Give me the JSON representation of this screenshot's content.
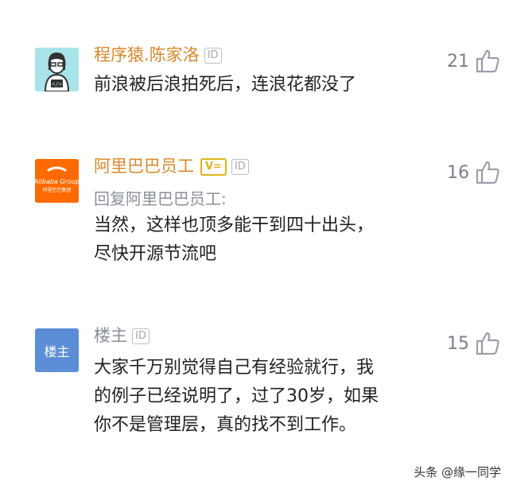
{
  "comments": [
    {
      "username": "程序猿.陈家洛",
      "id_tag": "ID",
      "text": "前浪被后浪拍死后，连浪花都没了",
      "likes": "21",
      "avatar": "programmer-avatar-icon"
    },
    {
      "username": "阿里巴巴员工",
      "v_tag": "V=",
      "id_tag": "ID",
      "reply_to": "回复阿里巴巴员工:",
      "text": "当然，这样也顶多能干到四十出头，\n尽快开源节流吧",
      "likes": "16",
      "avatar_text": "Alibaba Group",
      "avatar_sub": "阿里巴巴集团"
    },
    {
      "username": "楼主",
      "id_tag": "ID",
      "text": "大家千万别觉得自己有经验就行，我\n的例子已经说明了，过了30岁，如果\n你不是管理层，真的找不到工作。",
      "likes": "15",
      "avatar_text": "楼主"
    }
  ],
  "watermark": "头条 @缘一同学",
  "colors": {
    "username": "#d9882a",
    "body": "#222222",
    "muted": "#8a8f99",
    "alibaba_orange": "#ff6a00",
    "op_avatar": "#5b8ed6"
  }
}
